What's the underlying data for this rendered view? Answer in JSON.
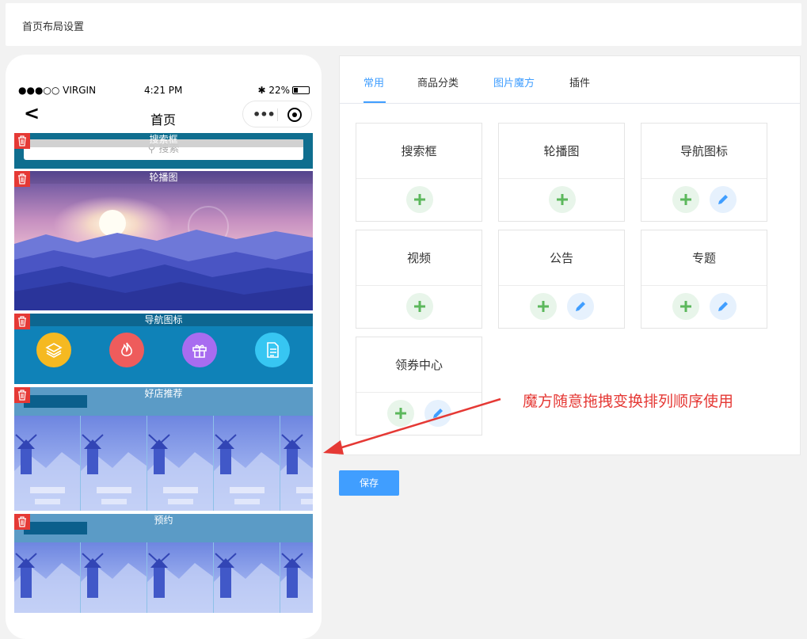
{
  "page": {
    "title": "首页布局设置"
  },
  "phone": {
    "carrier": "●●●○○ VIRGIN",
    "time": "4:21 PM",
    "battery": "22%",
    "nav_title": "首页",
    "nav_back": "<",
    "search_module": {
      "title": "搜索框",
      "placeholder": "搜索"
    },
    "banner_module": {
      "title": "轮播图"
    },
    "nav_module": {
      "title": "导航图标",
      "icons": [
        {
          "name": "layers-icon",
          "color": "#f5b921"
        },
        {
          "name": "fire-icon",
          "color": "#ee5c5c"
        },
        {
          "name": "gift-icon",
          "color": "#a86cf0"
        },
        {
          "name": "document-icon",
          "color": "#37c6f2"
        }
      ]
    },
    "shop_module": {
      "title": "好店推荐"
    },
    "book_module": {
      "title": "预约"
    }
  },
  "panel": {
    "tabs": [
      {
        "label": "常用",
        "active": true
      },
      {
        "label": "商品分类",
        "active": false
      },
      {
        "label": "图片魔方",
        "active": false
      },
      {
        "label": "插件",
        "active": false
      }
    ],
    "cards": [
      {
        "name": "搜索框",
        "editable": false
      },
      {
        "name": "轮播图",
        "editable": false
      },
      {
        "name": "导航图标",
        "editable": true
      },
      {
        "name": "视频",
        "editable": false
      },
      {
        "name": "公告",
        "editable": true
      },
      {
        "name": "专题",
        "editable": true
      },
      {
        "name": "领券中心",
        "editable": true
      }
    ],
    "save_label": "保存"
  },
  "annotation": "魔方随意拖拽变换排列顺序使用",
  "colors": {
    "accent": "#409eff",
    "danger": "#e53935",
    "add_green": "#5cb85c"
  }
}
